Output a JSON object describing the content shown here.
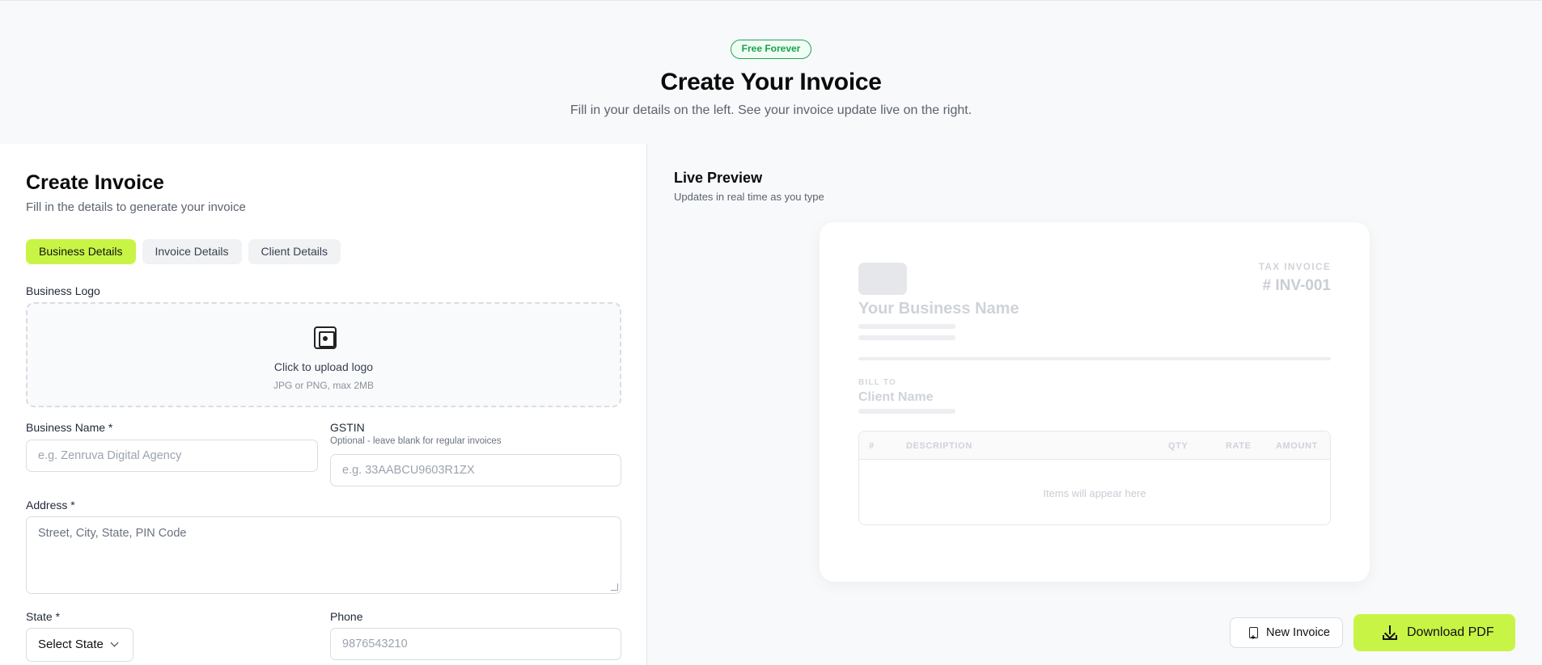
{
  "hero": {
    "badge": "Free Forever",
    "title": "Create Your Invoice",
    "subtitle": "Fill in your details on the left. See your invoice update live on the right."
  },
  "form": {
    "title": "Create Invoice",
    "subtitle": "Fill in the details to generate your invoice",
    "tabs": [
      {
        "label": "Business Details",
        "active": true
      },
      {
        "label": "Invoice Details",
        "active": false
      },
      {
        "label": "Client Details",
        "active": false
      }
    ],
    "logo": {
      "label": "Business Logo",
      "icon": "image-icon",
      "text": "Click to upload logo",
      "hint": "JPG or PNG, max 2MB"
    },
    "business_name": {
      "label": "Business Name *",
      "placeholder": "e.g. Zenruva Digital Agency"
    },
    "gstin": {
      "label": "GSTIN",
      "hint": "Optional - leave blank for regular invoices",
      "placeholder": "e.g. 33AABCU9603R1ZX"
    },
    "address": {
      "label": "Address *",
      "placeholder": "Street, City, State, PIN Code"
    },
    "state": {
      "label": "State *",
      "value": "Select State"
    },
    "phone": {
      "label": "Phone",
      "placeholder": "9876543210"
    }
  },
  "preview": {
    "title": "Live Preview",
    "subtitle": "Updates in real time as you type",
    "invoice": {
      "tax_label": "TAX INVOICE",
      "number": "# INV-001",
      "business_name": "Your Business Name",
      "bill_to": "BILL TO",
      "client_name": "Client Name",
      "columns": [
        "#",
        "DESCRIPTION",
        "QTY",
        "RATE",
        "AMOUNT"
      ],
      "empty_text": "Items will appear here"
    }
  },
  "actions": {
    "new_invoice": "New Invoice",
    "download_pdf": "Download PDF"
  },
  "colors": {
    "accent": "#c8f545",
    "badge_green": "#16a34a"
  }
}
